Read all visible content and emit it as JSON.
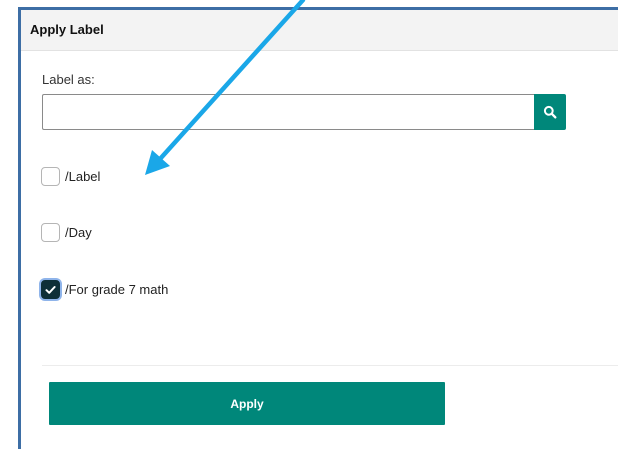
{
  "dialog": {
    "title": "Apply Label"
  },
  "label_field": {
    "label": "Label as:",
    "value": "",
    "placeholder": "",
    "search_icon": "search-icon"
  },
  "options": [
    {
      "label": "/Label",
      "checked": false
    },
    {
      "label": "/Day",
      "checked": false
    },
    {
      "label": "/For grade 7 math",
      "checked": true
    }
  ],
  "footer": {
    "apply_label": "Apply"
  },
  "annotation": {
    "icon": "arrow-icon"
  },
  "colors": {
    "accent": "#00877a",
    "panel_border": "#3d6ea5",
    "checked_box": "#0e2f37",
    "annotation_arrow": "#1aa7e8"
  }
}
